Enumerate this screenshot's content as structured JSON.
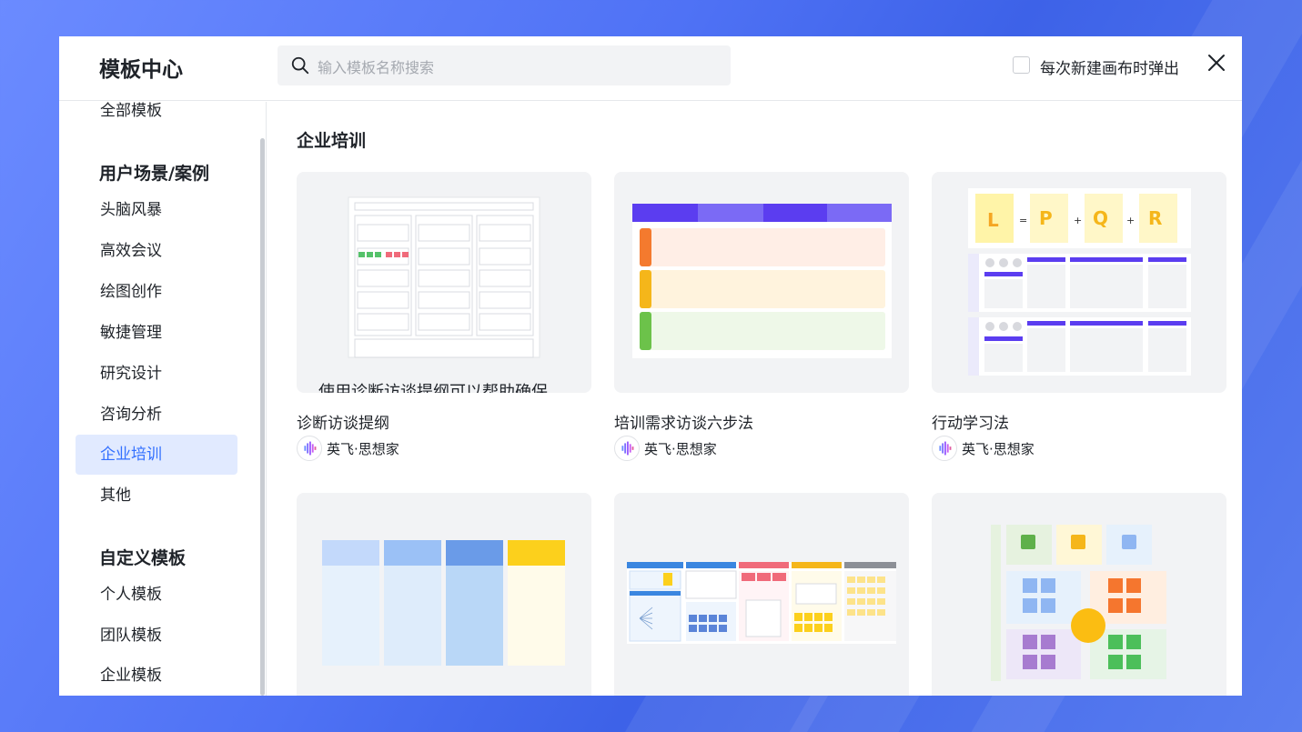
{
  "header": {
    "title": "模板中心",
    "search_placeholder": "输入模板名称搜索",
    "popup_option_label": "每次新建画布时弹出",
    "popup_option_checked": false
  },
  "sidebar": {
    "all_templates": "全部模板",
    "group_scenarios": "用户场景/案例",
    "scenario_items": [
      "头脑风暴",
      "高效会议",
      "绘图创作",
      "敏捷管理",
      "研究设计",
      "咨询分析",
      "企业培训",
      "其他"
    ],
    "active_item": "企业培训",
    "group_custom": "自定义模板",
    "custom_items": [
      "个人模板",
      "团队模板",
      "企业模板"
    ]
  },
  "main": {
    "section_title": "企业培训",
    "cards": [
      {
        "name": "诊断访谈提纲",
        "author": "英飞·思想家",
        "preview_text": "使用诊断访谈提纲可以帮助确保"
      },
      {
        "name": "培训需求访谈六步法",
        "author": "英飞·思想家"
      },
      {
        "name": "行动学习法",
        "author": "英飞·思想家",
        "formula": [
          "L",
          "=",
          "P",
          "+",
          "Q",
          "+",
          "R"
        ]
      },
      {
        "name": "",
        "author": ""
      },
      {
        "name": "",
        "author": ""
      },
      {
        "name": "",
        "author": ""
      }
    ]
  },
  "colors": {
    "accent": "#3370ff",
    "active_bg": "#e1eaff",
    "purple": "#5b3df0"
  }
}
